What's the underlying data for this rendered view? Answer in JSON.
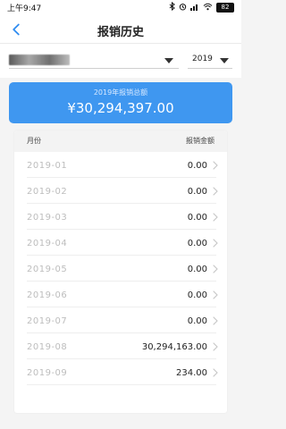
{
  "status_bar": {
    "time": "上午9:47",
    "battery": "82",
    "icons": [
      "bluetooth-icon",
      "alarm-icon",
      "signal-icon",
      "wifi-icon",
      "battery-icon"
    ]
  },
  "header": {
    "title": "报销历史",
    "back_icon": "back-chevron-icon"
  },
  "filters": {
    "department_value": "",
    "year_value": "2019"
  },
  "summary": {
    "label": "2019年报销总额",
    "amount": "¥30,294,397.00",
    "accent_color": "#3f97f0"
  },
  "table": {
    "columns": [
      "月份",
      "报销金额"
    ],
    "rows": [
      {
        "month": "2019-01",
        "amount": "0.00"
      },
      {
        "month": "2019-02",
        "amount": "0.00"
      },
      {
        "month": "2019-03",
        "amount": "0.00"
      },
      {
        "month": "2019-04",
        "amount": "0.00"
      },
      {
        "month": "2019-05",
        "amount": "0.00"
      },
      {
        "month": "2019-06",
        "amount": "0.00"
      },
      {
        "month": "2019-07",
        "amount": "0.00"
      },
      {
        "month": "2019-08",
        "amount": "30,294,163.00"
      },
      {
        "month": "2019-09",
        "amount": "234.00"
      }
    ]
  }
}
